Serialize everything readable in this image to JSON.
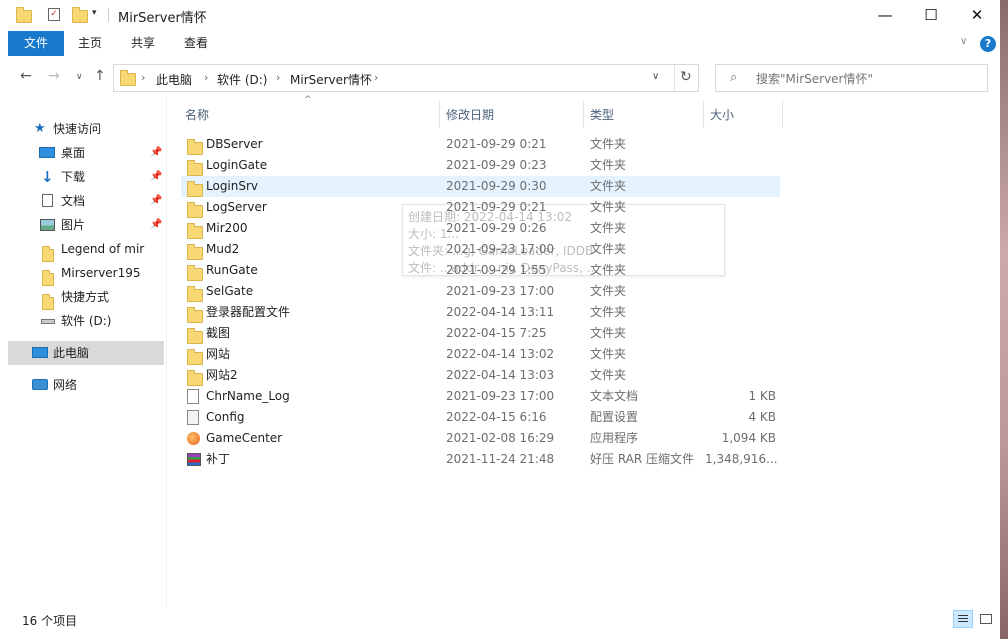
{
  "window": {
    "title": "MirServer情怀",
    "controls": {
      "minimize": "—",
      "maximize": "☐",
      "close": "✕"
    }
  },
  "ribbon": {
    "tabs": [
      "文件",
      "主页",
      "共享",
      "查看"
    ]
  },
  "address": {
    "crumbs": [
      "此电脑",
      "软件 (D:)",
      "MirServer情怀"
    ]
  },
  "search": {
    "placeholder": "搜索\"MirServer情怀\""
  },
  "nav": {
    "items": [
      {
        "label": "快速访问",
        "icon": "star-icon"
      },
      {
        "label": "桌面",
        "icon": "desktop-icon",
        "pinned": true
      },
      {
        "label": "下载",
        "icon": "download-icon",
        "pinned": true
      },
      {
        "label": "文档",
        "icon": "document-icon",
        "pinned": true
      },
      {
        "label": "图片",
        "icon": "picture-icon",
        "pinned": true
      },
      {
        "label": "Legend of mir",
        "icon": "folder-icon"
      },
      {
        "label": "Mirserver195",
        "icon": "folder-icon"
      },
      {
        "label": "快捷方式",
        "icon": "folder-icon"
      },
      {
        "label": "软件 (D:)",
        "icon": "drive-icon"
      },
      {
        "label": "此电脑",
        "icon": "computer-icon",
        "selected": true
      },
      {
        "label": "网络",
        "icon": "network-icon"
      }
    ]
  },
  "columns": {
    "name": "名称",
    "date": "修改日期",
    "type": "类型",
    "size": "大小"
  },
  "files": [
    {
      "name": "DBServer",
      "date": "2021-09-29 0:21",
      "type": "文件夹",
      "size": "",
      "icon": "folder"
    },
    {
      "name": "LoginGate",
      "date": "2021-09-29 0:23",
      "type": "文件夹",
      "size": "",
      "icon": "folder"
    },
    {
      "name": "LoginSrv",
      "date": "2021-09-29 0:30",
      "type": "文件夹",
      "size": "",
      "icon": "folder",
      "hover": true
    },
    {
      "name": "LogServer",
      "date": "2021-09-29 0:21",
      "type": "文件夹",
      "size": "",
      "icon": "folder"
    },
    {
      "name": "Mir200",
      "date": "2021-09-29 0:26",
      "type": "文件夹",
      "size": "",
      "icon": "folder"
    },
    {
      "name": "Mud2",
      "date": "2021-09-23 17:00",
      "type": "文件夹",
      "size": "",
      "icon": "folder"
    },
    {
      "name": "RunGate",
      "date": "2021-09-29 1:55",
      "type": "文件夹",
      "size": "",
      "icon": "folder"
    },
    {
      "name": "SelGate",
      "date": "2021-09-23 17:00",
      "type": "文件夹",
      "size": "",
      "icon": "folder"
    },
    {
      "name": "登录器配置文件",
      "date": "2022-04-14 13:11",
      "type": "文件夹",
      "size": "",
      "icon": "folder"
    },
    {
      "name": "截图",
      "date": "2022-04-15 7:25",
      "type": "文件夹",
      "size": "",
      "icon": "folder"
    },
    {
      "name": "网站",
      "date": "2022-04-14 13:02",
      "type": "文件夹",
      "size": "",
      "icon": "folder"
    },
    {
      "name": "网站2",
      "date": "2022-04-14 13:03",
      "type": "文件夹",
      "size": "",
      "icon": "folder"
    },
    {
      "name": "ChrName_Log",
      "date": "2021-09-23 17:00",
      "type": "文本文档",
      "size": "1 KB",
      "icon": "text"
    },
    {
      "name": "Config",
      "date": "2022-04-15 6:16",
      "type": "配置设置",
      "size": "4 KB",
      "icon": "config"
    },
    {
      "name": "GameCenter",
      "date": "2021-02-08 16:29",
      "type": "应用程序",
      "size": "1,094 KB",
      "icon": "app"
    },
    {
      "name": "补丁",
      "date": "2021-11-24 21:48",
      "type": "好压 RAR 压缩文件",
      "size": "1,348,916...",
      "icon": "rar"
    }
  ],
  "tooltip": {
    "lines": [
      "创建日期: 2022-04-14 13:02",
      "大小: 1...",
      "文件夹: ...g, GameLoader, IDDB",
      "文件: ...addr, ...nit, DenyPass, ..."
    ]
  },
  "status": {
    "count": "16 个项目"
  }
}
